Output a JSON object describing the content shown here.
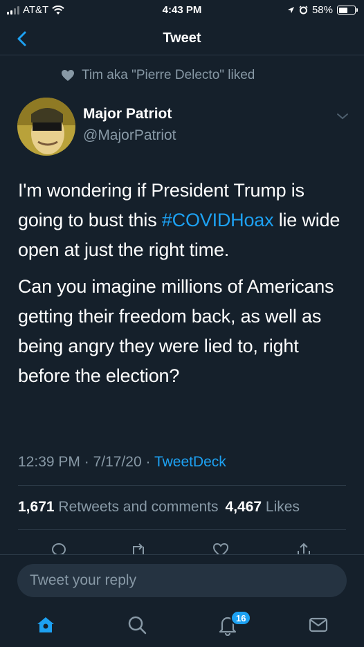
{
  "status_bar": {
    "carrier": "AT&T",
    "time": "4:43 PM",
    "battery": "58%",
    "battery_level": 0.58
  },
  "nav": {
    "title": "Tweet",
    "back_icon": "chevron-left-icon"
  },
  "social_context": {
    "icon": "heart-icon",
    "text": "Tim aka \"Pierre Delecto\" liked"
  },
  "author": {
    "name": "Major Patriot",
    "handle": "@MajorPatriot"
  },
  "tweet": {
    "p1_before": "I'm wondering if President Trump is going to bust this ",
    "hashtag": "#COVIDHoax",
    "p1_after": " lie wide open at just the right time.",
    "p2": "Can you imagine millions of Americans getting their freedom back, as well as being angry they were lied to, right before the election?"
  },
  "meta": {
    "time": "12:39 PM",
    "date": "7/17/20",
    "source": "TweetDeck",
    "separator": " · "
  },
  "stats": {
    "retweets_count": "1,671",
    "retweets_label": "Retweets and comments",
    "likes_count": "4,467",
    "likes_label": "Likes"
  },
  "actions": [
    "reply-icon",
    "retweet-icon",
    "like-icon",
    "share-icon"
  ],
  "composer": {
    "placeholder": "Tweet your reply"
  },
  "tab_bar": {
    "tabs": [
      "home-icon",
      "search-icon",
      "notifications-icon",
      "messages-icon"
    ],
    "notification_badge": "16"
  },
  "colors": {
    "background": "#15202b",
    "accent": "#1da1f2",
    "secondary_text": "#8899a6",
    "divider": "#2c3a47"
  }
}
